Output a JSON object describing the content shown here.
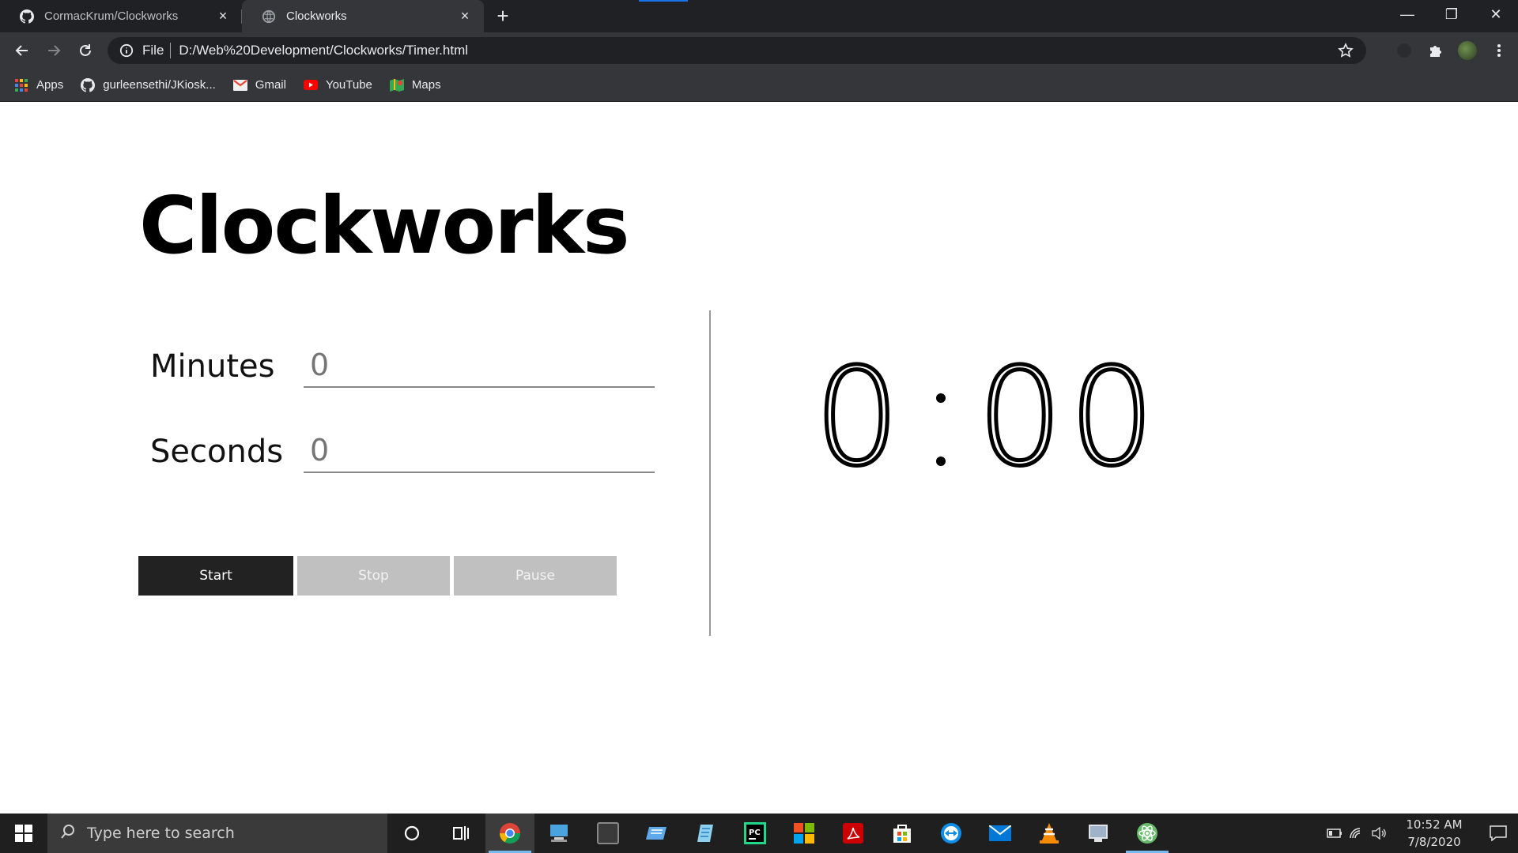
{
  "browser": {
    "tabs": [
      {
        "title": "CormacKrum/Clockworks",
        "favicon": "github-icon",
        "active": false
      },
      {
        "title": "Clockworks",
        "favicon": "globe-icon",
        "active": true
      }
    ],
    "new_tab_label": "+",
    "close_glyph": "×",
    "window_controls": {
      "minimize": "—",
      "restore": "❐",
      "close": "✕"
    },
    "address": {
      "scheme": "File",
      "url": "D:/Web%20Development/Clockworks/Timer.html"
    },
    "bookmarks": [
      {
        "label": "Apps",
        "icon": "apps-grid-icon"
      },
      {
        "label": "gurleensethi/JKiosk...",
        "icon": "github-icon"
      },
      {
        "label": "Gmail",
        "icon": "gmail-icon"
      },
      {
        "label": "YouTube",
        "icon": "youtube-icon"
      },
      {
        "label": "Maps",
        "icon": "maps-icon"
      }
    ]
  },
  "page": {
    "title": "Clockworks",
    "fields": [
      {
        "label": "Minutes",
        "value": "",
        "placeholder": "0"
      },
      {
        "label": "Seconds",
        "value": "",
        "placeholder": "0"
      }
    ],
    "buttons": {
      "start": "Start",
      "stop": "Stop",
      "pause": "Pause"
    },
    "timer": {
      "minutes": "0",
      "seconds": "00"
    }
  },
  "taskbar": {
    "search_placeholder": "Type here to search",
    "time": "10:52 AM",
    "date": "7/8/2020",
    "apps": [
      "cortana-icon",
      "task-view-icon",
      "chrome-icon",
      "computer-icon",
      "terminal-icon",
      "vmware-icon",
      "notepad-icon",
      "pycharm-icon",
      "office-icon",
      "acrobat-icon",
      "store-icon",
      "teamviewer-icon",
      "mail-icon",
      "vlc-icon",
      "app-icon",
      "atom-icon"
    ]
  },
  "colors": {
    "chrome_dark": "#202124",
    "chrome_mid": "#35363a",
    "button_primary": "#222222",
    "button_disabled": "#c0c0c0",
    "taskbar": "#1f1f1f",
    "accent": "#76b9ed"
  }
}
